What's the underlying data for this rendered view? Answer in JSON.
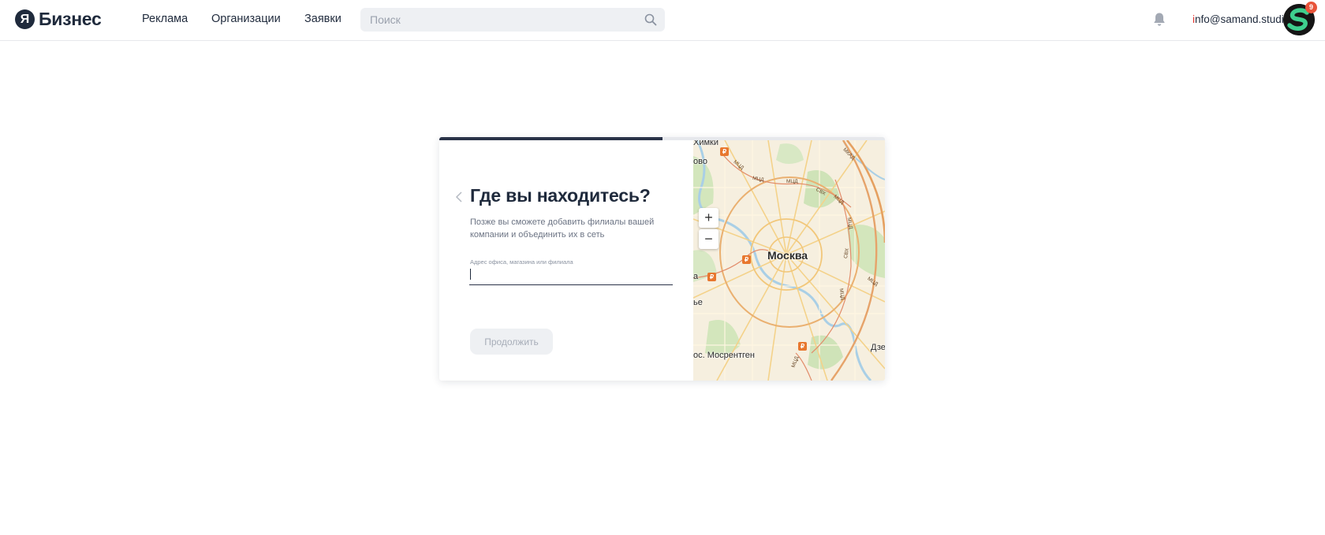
{
  "header": {
    "logo_mark": "Я",
    "logo_text": "Бизнес",
    "nav": [
      "Реклама",
      "Организации",
      "Заявки"
    ],
    "search_placeholder": "Поиск",
    "email_first": "i",
    "email_rest": "nfo@samand.studio",
    "notification_count": "9"
  },
  "progress": 0.5,
  "card": {
    "title": "Где вы находитесь?",
    "subtitle": "Позже вы сможете добавить филиалы вашей компании и объединить их в сеть",
    "field_label": "Адрес офиса, магазина или филиала",
    "address_value": "",
    "continue_label": "Продолжить"
  },
  "map": {
    "zoom_in": "+",
    "zoom_out": "−",
    "city": "Москва",
    "labels": [
      "Химки",
      "ово",
      "а",
      "ье",
      "ос. Мосрентген",
      "Дзе"
    ],
    "road_labels": [
      "МКАД",
      "МЦД",
      "МЦД",
      "МЦД",
      "СВХ",
      "МЦД",
      "МЦД",
      "СВХ",
      "МЦД",
      "МЦД",
      "МЦД"
    ],
    "metro_symbol": "₽"
  }
}
